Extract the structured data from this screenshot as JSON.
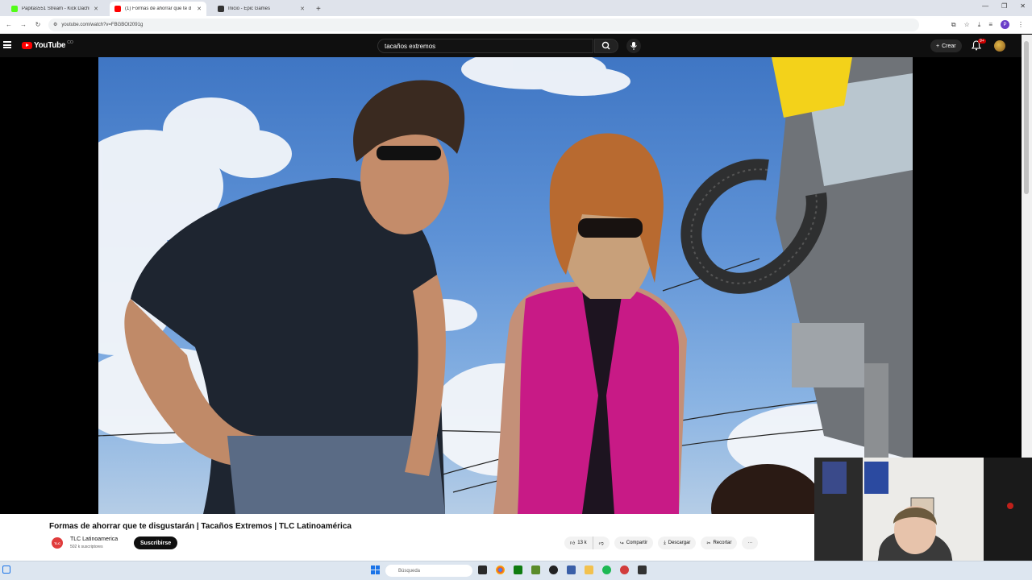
{
  "browser": {
    "tabs": [
      {
        "title": "Papitas551 Stream - Kick Dachi",
        "active": false,
        "favicon_color": "#53fc18"
      },
      {
        "title": "(1) Formas de ahorrar que te d",
        "active": true,
        "favicon_color": "#ff0000"
      },
      {
        "title": "Inicio - Epic Games",
        "active": false,
        "favicon_color": "#333333"
      }
    ],
    "url": "youtube.com/watch?v=FBGBOt2091g",
    "profile_initial": "P"
  },
  "youtube": {
    "logo_text": "YouTube",
    "logo_region": "CO",
    "search_query": "tacaños extremos",
    "create_label": "Crear",
    "notification_count": "9+"
  },
  "video": {
    "title": "Formas de ahorrar que te disgustarán | Tacaños Extremos | TLC Latinoamérica",
    "channel_name": "TLC Latinoamerica",
    "channel_avatar_text": "TLC",
    "subscribers": "502 k suscriptores",
    "subscribe_label": "Suscribirse",
    "likes": "13 k",
    "share_label": "Compartir",
    "download_label": "Descargar",
    "clip_label": "Recortar",
    "more_label": "···"
  },
  "taskbar": {
    "search_placeholder": "Búsqueda"
  }
}
